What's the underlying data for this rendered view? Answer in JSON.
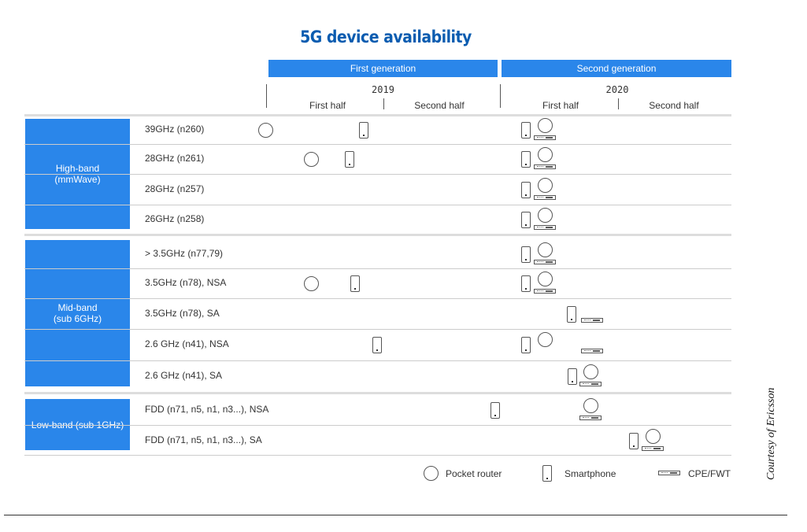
{
  "title": "5G device availability",
  "generations": [
    "First generation",
    "Second generation"
  ],
  "years": [
    "2019",
    "2020"
  ],
  "halves": [
    "First half",
    "Second half"
  ],
  "bands": [
    {
      "label": "High-band\n(mmWave)"
    },
    {
      "label": "Mid-band\n(sub 6GHz)"
    },
    {
      "label": "Low-band (sub 1GHz)"
    }
  ],
  "rows": [
    {
      "label": "39GHz (n260)",
      "devices": [
        "pocket-router",
        "smartphone",
        "smartphone",
        "pocket-router",
        "cpe-fwt"
      ]
    },
    {
      "label": "28GHz (n261)",
      "devices": [
        "pocket-router",
        "smartphone",
        "smartphone",
        "pocket-router",
        "cpe-fwt"
      ]
    },
    {
      "label": "28GHz (n257)",
      "devices": [
        "smartphone",
        "pocket-router",
        "cpe-fwt"
      ]
    },
    {
      "label": "26GHz (n258)",
      "devices": [
        "smartphone",
        "pocket-router",
        "cpe-fwt"
      ]
    },
    {
      "label": "> 3.5GHz (n77,79)",
      "devices": [
        "smartphone",
        "pocket-router",
        "cpe-fwt"
      ]
    },
    {
      "label": "3.5GHz (n78), NSA",
      "devices": [
        "pocket-router",
        "smartphone",
        "smartphone",
        "pocket-router",
        "cpe-fwt"
      ]
    },
    {
      "label": "3.5GHz (n78), SA",
      "devices": [
        "smartphone",
        "cpe-fwt"
      ]
    },
    {
      "label": "2.6 GHz (n41), NSA",
      "devices": [
        "smartphone",
        "smartphone",
        "pocket-router",
        "cpe-fwt"
      ]
    },
    {
      "label": "2.6 GHz (n41), SA",
      "devices": [
        "smartphone",
        "pocket-router",
        "cpe-fwt"
      ]
    },
    {
      "label": "FDD (n71, n5, n1, n3...), NSA",
      "devices": [
        "smartphone",
        "pocket-router",
        "cpe-fwt"
      ]
    },
    {
      "label": "FDD (n71, n5, n1, n3...), SA",
      "devices": [
        "smartphone",
        "pocket-router",
        "cpe-fwt"
      ]
    }
  ],
  "legend": [
    {
      "icon": "pocket-router",
      "label": "Pocket router"
    },
    {
      "icon": "smartphone",
      "label": "Smartphone"
    },
    {
      "icon": "cpe-fwt",
      "label": "CPE/FWT"
    }
  ],
  "courtesy": "Courtesy of Ericsson",
  "colors": {
    "accent": "#2a86ea",
    "title": "#0a5cb0"
  }
}
